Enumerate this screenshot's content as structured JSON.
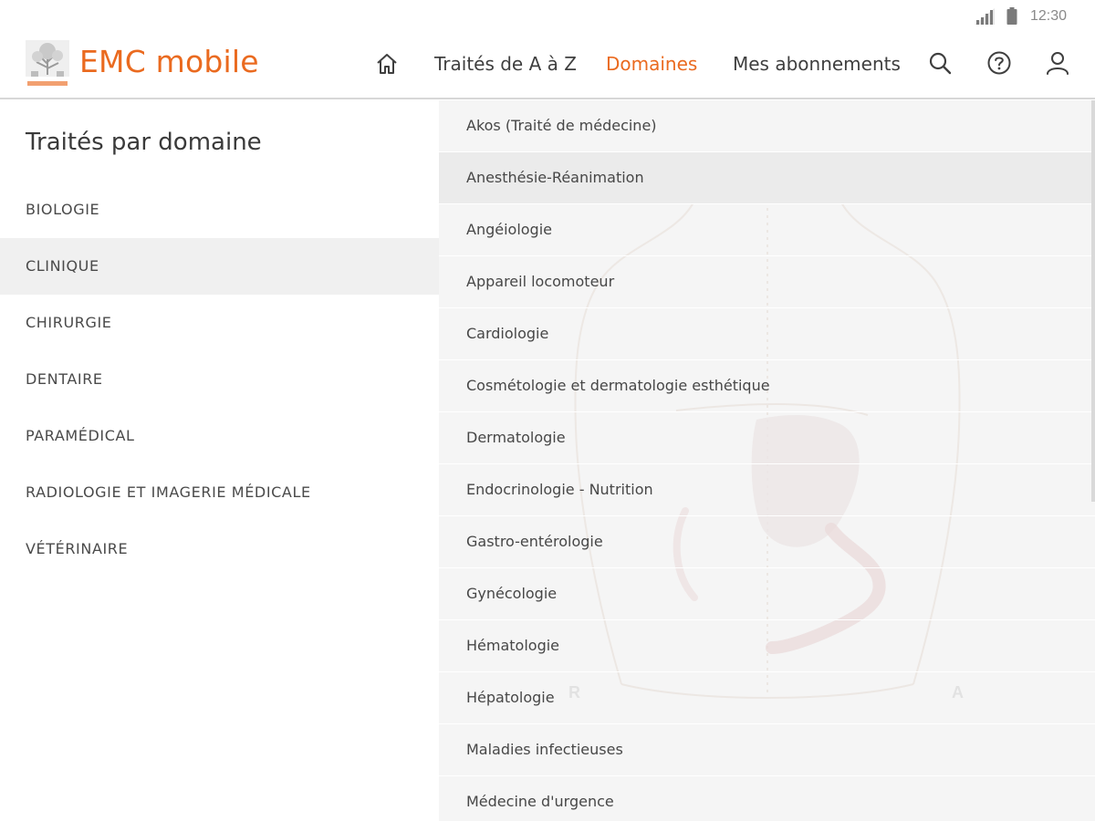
{
  "status": {
    "time": "12:30",
    "signal_icon": "signal-icon",
    "battery_icon": "battery-icon"
  },
  "header": {
    "app_title": "EMC mobile",
    "logo_icon": "elsevier-logo",
    "nav": {
      "home_icon": "home-icon",
      "traites": "Traités de A à Z",
      "domaines": "Domaines",
      "abonnements": "Mes abonnements"
    },
    "icons": [
      "search-icon",
      "help-icon",
      "user-icon"
    ]
  },
  "left": {
    "title": "Traités par domaine",
    "items": [
      "BIOLOGIE",
      "CLINIQUE",
      "CHIRURGIE",
      "DENTAIRE",
      "PARAMÉDICAL",
      "RADIOLOGIE ET IMAGERIE MÉDICALE",
      "VÉTÉRINAIRE"
    ],
    "selected": "CLINIQUE"
  },
  "right": {
    "items": [
      "Akos (Traité de médecine)",
      "Anesthésie-Réanimation",
      "Angéiologie",
      "Appareil locomoteur",
      "Cardiologie",
      "Cosmétologie et dermatologie esthétique",
      "Dermatologie",
      "Endocrinologie - Nutrition",
      "Gastro-entérologie",
      "Gynécologie",
      "Hématologie",
      "Hépatologie",
      "Maladies infectieuses",
      "Médecine d'urgence"
    ],
    "highlighted": "Anesthésie-Réanimation"
  },
  "colors": {
    "accent": "#ea6a1f",
    "panel_bg": "#f5f5f5",
    "selected_bg": "#f0f0f0"
  }
}
